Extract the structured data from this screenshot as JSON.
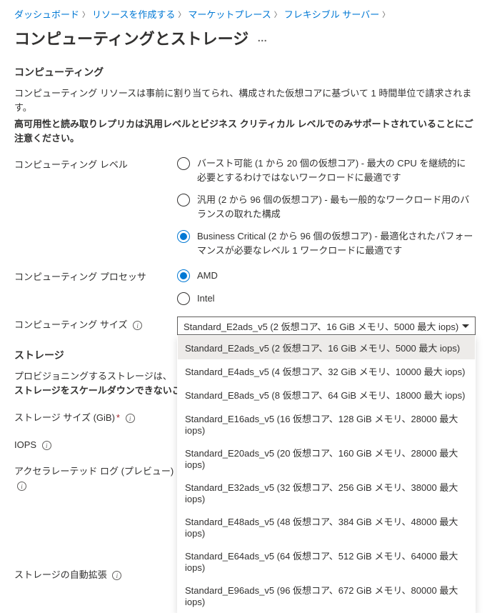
{
  "breadcrumb": {
    "items": [
      {
        "label": "ダッシュボード"
      },
      {
        "label": "リソースを作成する"
      },
      {
        "label": "マーケットプレース"
      },
      {
        "label": "フレキシブル サーバー"
      }
    ]
  },
  "page_title": "コンピューティングとストレージ",
  "compute": {
    "heading": "コンピューティング",
    "desc": "コンピューティング リソースは事前に割り当てられ、構成された仮想コアに基づいて 1 時間単位で請求されます。",
    "desc_bold": "高可用性と読み取りレプリカは汎用レベルとビジネス クリティカル レベルでのみサポートされていることにご注意ください。",
    "level": {
      "label": "コンピューティング レベル",
      "options": [
        "バースト可能 (1 から 20 個の仮想コア) - 最大の CPU を継続的に必要とするわけではないワークロードに最適です",
        "汎用 (2 から 96 個の仮想コア) - 最も一般的なワークロード用のバランスの取れた構成",
        "Business Critical (2 から 96 個の仮想コア) - 最適化されたパフォーマンスが必要なレベル 1 ワークロードに最適です"
      ],
      "selected": 2
    },
    "processor": {
      "label": "コンピューティング プロセッサ",
      "options": [
        "AMD",
        "Intel"
      ],
      "selected": 0
    },
    "size": {
      "label": "コンピューティング サイズ",
      "selected_value": "Standard_E2ads_v5 (2 仮想コア、16 GiB メモリ、5000 最大 iops)",
      "options": [
        "Standard_E2ads_v5 (2 仮想コア、16 GiB メモリ、5000 最大 iops)",
        "Standard_E4ads_v5 (4 仮想コア、32 GiB メモリ、10000 最大 iops)",
        "Standard_E8ads_v5 (8 仮想コア、64 GiB メモリ、18000 最大 iops)",
        "Standard_E16ads_v5 (16 仮想コア、128 GiB メモリ、28000 最大 iops)",
        "Standard_E20ads_v5 (20 仮想コア、160 GiB メモリ、28000 最大 iops)",
        "Standard_E32ads_v5 (32 仮想コア、256 GiB メモリ、38000 最大 iops)",
        "Standard_E48ads_v5 (48 仮想コア、384 GiB メモリ、48000 最大 iops)",
        "Standard_E64ads_v5 (64 仮想コア、512 GiB メモリ、64000 最大 iops)",
        "Standard_E96ads_v5 (96 仮想コア、672 GiB メモリ、80000 最大 iops)"
      ]
    }
  },
  "storage": {
    "heading": "ストレージ",
    "desc_prefix": "プロビジョニングするストレージは、",
    "desc_bold": "ストレージをスケールダウンできないことにご注意ください",
    "size_label": "ストレージ サイズ (GiB)",
    "iops_label": "IOPS",
    "accel_log_label": "アクセラレーテッド ログ (プレビュー)",
    "auto_grow_label": "ストレージの自動拡張"
  }
}
